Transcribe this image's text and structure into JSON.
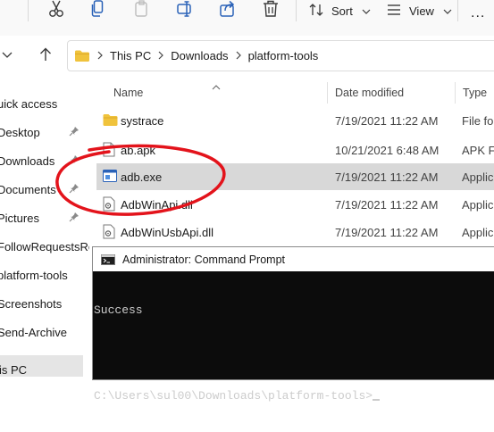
{
  "toolbar": {
    "sort_label": "Sort",
    "view_label": "View",
    "more_label": "..."
  },
  "address": {
    "crumbs": [
      "This PC",
      "Downloads",
      "platform-tools"
    ]
  },
  "nav": {
    "items": [
      {
        "label": "uick access",
        "pinned": false
      },
      {
        "label": "Desktop",
        "pinned": true
      },
      {
        "label": "Downloads",
        "pinned": true
      },
      {
        "label": "Documents",
        "pinned": true
      },
      {
        "label": "Pictures",
        "pinned": true
      },
      {
        "label": "FollowRequestsRen",
        "pinned": false
      },
      {
        "label": "platform-tools",
        "pinned": false
      },
      {
        "label": "Screenshots",
        "pinned": false
      },
      {
        "label": "Send-Archive",
        "pinned": false
      },
      {
        "label": "is PC",
        "pinned": false
      }
    ]
  },
  "columns": {
    "name": "Name",
    "date": "Date modified",
    "type": "Type"
  },
  "files": [
    {
      "name": "systrace",
      "date": "7/19/2021 11:22 AM",
      "type": "File fol",
      "icon": "folder-icon"
    },
    {
      "name": "ab.apk",
      "date": "10/21/2021 6:48 AM",
      "type": "APK Fi",
      "icon": "file-icon"
    },
    {
      "name": "adb.exe",
      "date": "7/19/2021 11:22 AM",
      "type": "Applic",
      "icon": "exe-icon"
    },
    {
      "name": "AdbWinApi.dll",
      "date": "7/19/2021 11:22 AM",
      "type": "Applic",
      "icon": "dll-icon"
    },
    {
      "name": "AdbWinUsbApi.dll",
      "date": "7/19/2021 11:22 AM",
      "type": "Applic",
      "icon": "dll-icon"
    }
  ],
  "cmd": {
    "title": "Administrator: Command Prompt",
    "lines": [
      "Success",
      "",
      "C:\\Users\\sul00\\Downloads\\platform-tools>"
    ]
  },
  "colors": {
    "annotation": "#e3131b",
    "folder": "#f0c33c",
    "selected_row": "#d8d8d8",
    "console_bg": "#0c0c0c",
    "console_text": "#cccccc"
  }
}
